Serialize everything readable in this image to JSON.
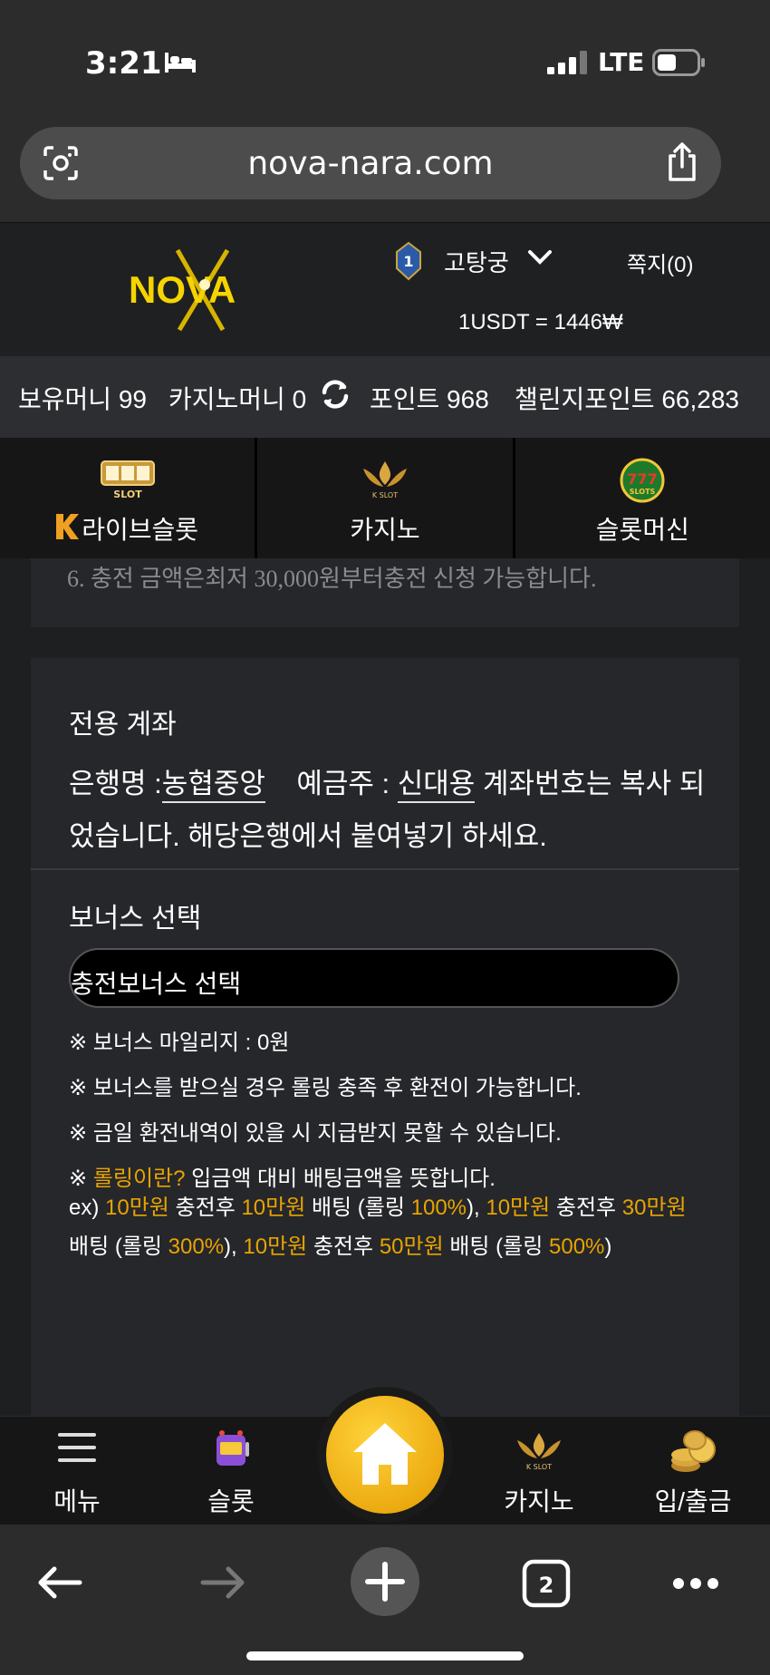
{
  "status_bar": {
    "time": "3:21",
    "network": "LTE"
  },
  "browser": {
    "url": "nova-nara.com",
    "tab_count": "2"
  },
  "header": {
    "logo_text": "NOVA",
    "level": "1",
    "username": "고탕궁",
    "messages": "쪽지(0)",
    "exchange_rate": "1USDT = 1446₩"
  },
  "money_bar": {
    "holding": "보유머니 99",
    "casino_money": "카지노머니 0",
    "points": "포인트 968",
    "challenge_points": "챌린지포인트 66,283"
  },
  "categories": [
    {
      "label": "라이브슬롯",
      "icon": "live-slot-icon"
    },
    {
      "label": "카지노",
      "icon": "k-slot-icon"
    },
    {
      "label": "슬롯머신",
      "icon": "slots-777-icon"
    }
  ],
  "notice": "6. 충전 금액은최저 30,000원부터충전 신청 가능합니다.",
  "account": {
    "title": "전용 계좌",
    "bank_label": "은행명 :",
    "bank_name": "농협중앙",
    "holder_label": "예금주 :",
    "holder_name": "신대용",
    "copied_msg_1": "계좌번호는 복사",
    "copied_msg_2": "되었습니다. 해당은행에서 붙여넣기 하세요."
  },
  "bonus": {
    "title": "보너스 선택",
    "select_value": "충전보너스 선택",
    "notes": {
      "mileage": "※ 보너스 마일리지 : 0원",
      "rolling_required": "※ 보너스를 받으실 경우 롤링 충족 후 환전이 가능합니다.",
      "no_pay": "※ 금일 환전내역이 있을 시 지급받지 못할 수 있습니다.",
      "rolling_prefix": "※ ",
      "rolling_hl": "롤링이란?",
      "rolling_desc": " 입금액 대비 배팅금액을 뜻합니다."
    },
    "example": {
      "ex": "ex) ",
      "a1": "10만원",
      "t1": " 충전후 ",
      "a2": "10만원",
      "t2": " 배팅 (롤링 ",
      "p1": "100%",
      "t3": "), ",
      "a3": "10만원",
      "t4": " 충전후 ",
      "a4": "30만원",
      "t5": " 배팅 (롤링 ",
      "p2": "300%",
      "t6": "), ",
      "a5": "10만원",
      "t7": " 충전후 ",
      "a6": "50만원",
      "t8": " 배팅 (롤링 ",
      "p3": "500%",
      "t9": ")"
    }
  },
  "bottom_nav": {
    "menu": "메뉴",
    "slot": "슬롯",
    "casino": "카지노",
    "deposit": "입/출금"
  },
  "colors": {
    "accent": "#e8a400",
    "panel": "#26272b",
    "background": "#1e1f21"
  }
}
